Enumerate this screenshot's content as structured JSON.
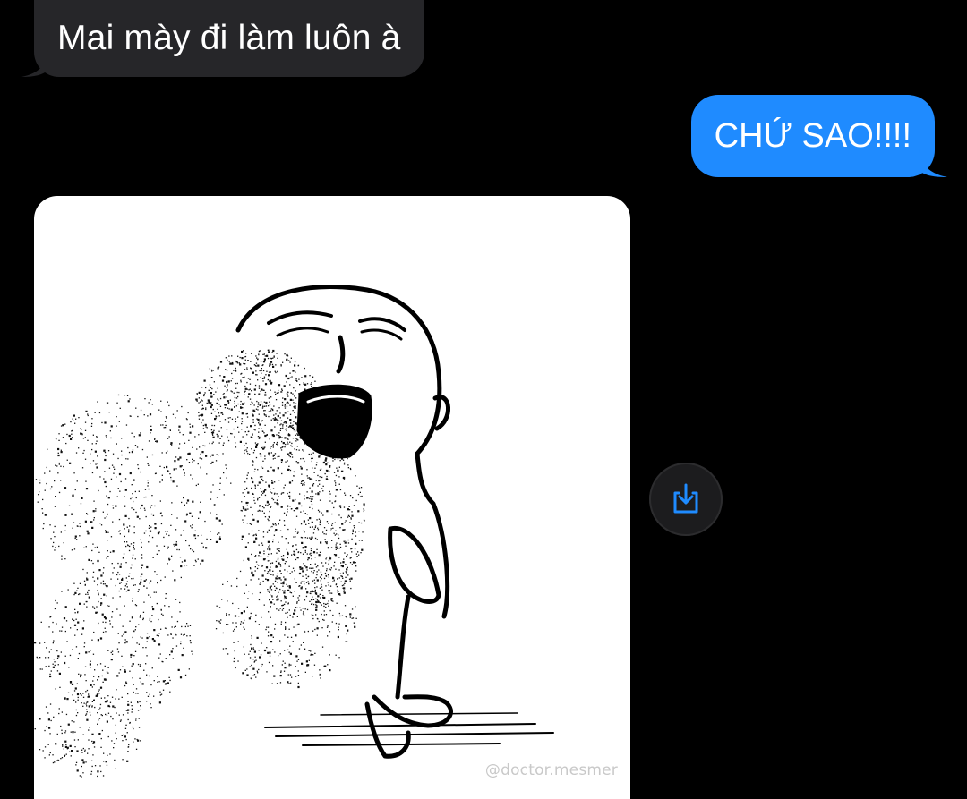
{
  "conversation": {
    "messages": [
      {
        "direction": "incoming",
        "text": "Mai mày đi làm luôn à"
      },
      {
        "direction": "outgoing",
        "text": "CHỨ SAO!!!!"
      }
    ],
    "attachment": {
      "kind": "image",
      "watermark": "@doctor.mesmer"
    },
    "save_button": {
      "icon": "save-download-icon"
    }
  },
  "colors": {
    "background": "#000000",
    "incoming_bubble": "#262629",
    "outgoing_bubble": "#1f8bff",
    "accent": "#1f8bff"
  }
}
